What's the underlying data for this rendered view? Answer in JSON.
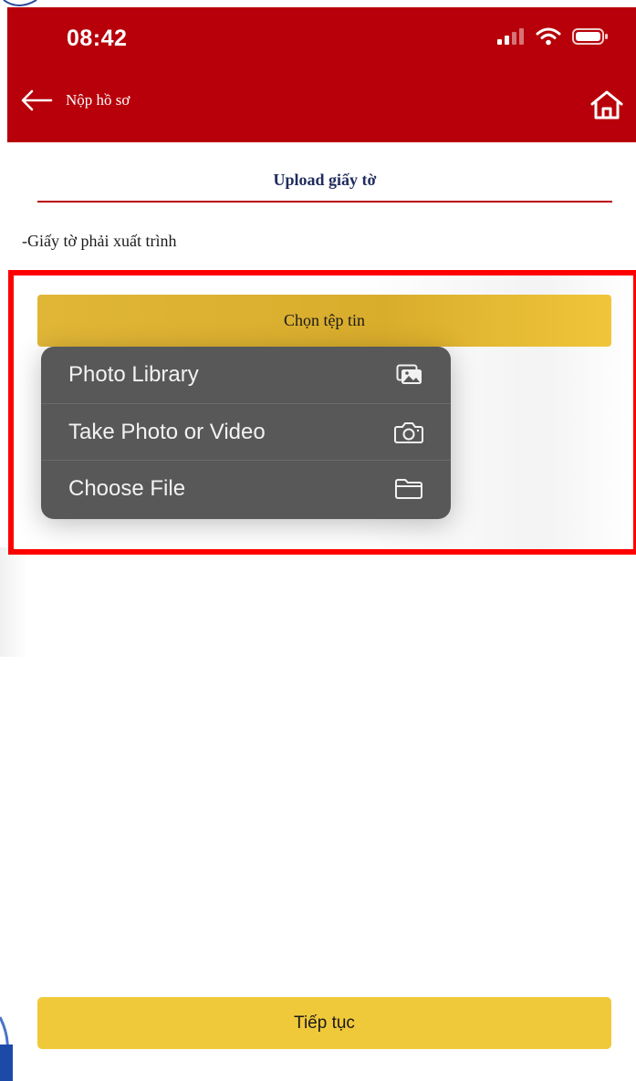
{
  "status_bar": {
    "time": "08:42",
    "icons": [
      "cellular-signal-icon",
      "wifi-icon",
      "battery-icon"
    ]
  },
  "header": {
    "back_label": "Nộp hồ sơ",
    "back_icon": "arrow-left-icon",
    "home_icon": "home-icon"
  },
  "section": {
    "title": "Upload giấy tờ",
    "requirement": "-Giấy tờ phải xuất trình"
  },
  "upload": {
    "choose_file_label": "Chọn tệp tin"
  },
  "picker_menu": {
    "items": [
      {
        "label": "Photo Library",
        "icon": "photo-library-icon"
      },
      {
        "label": "Take Photo or Video",
        "icon": "camera-icon"
      },
      {
        "label": "Choose File",
        "icon": "folder-icon"
      }
    ]
  },
  "footer": {
    "continue_label": "Tiếp tục"
  },
  "colors": {
    "header_red": "#b70009",
    "highlight_red": "#ff0000",
    "button_gold": "#f0c93b",
    "menu_gray": "#585858",
    "title_navy": "#1f2b5c"
  }
}
